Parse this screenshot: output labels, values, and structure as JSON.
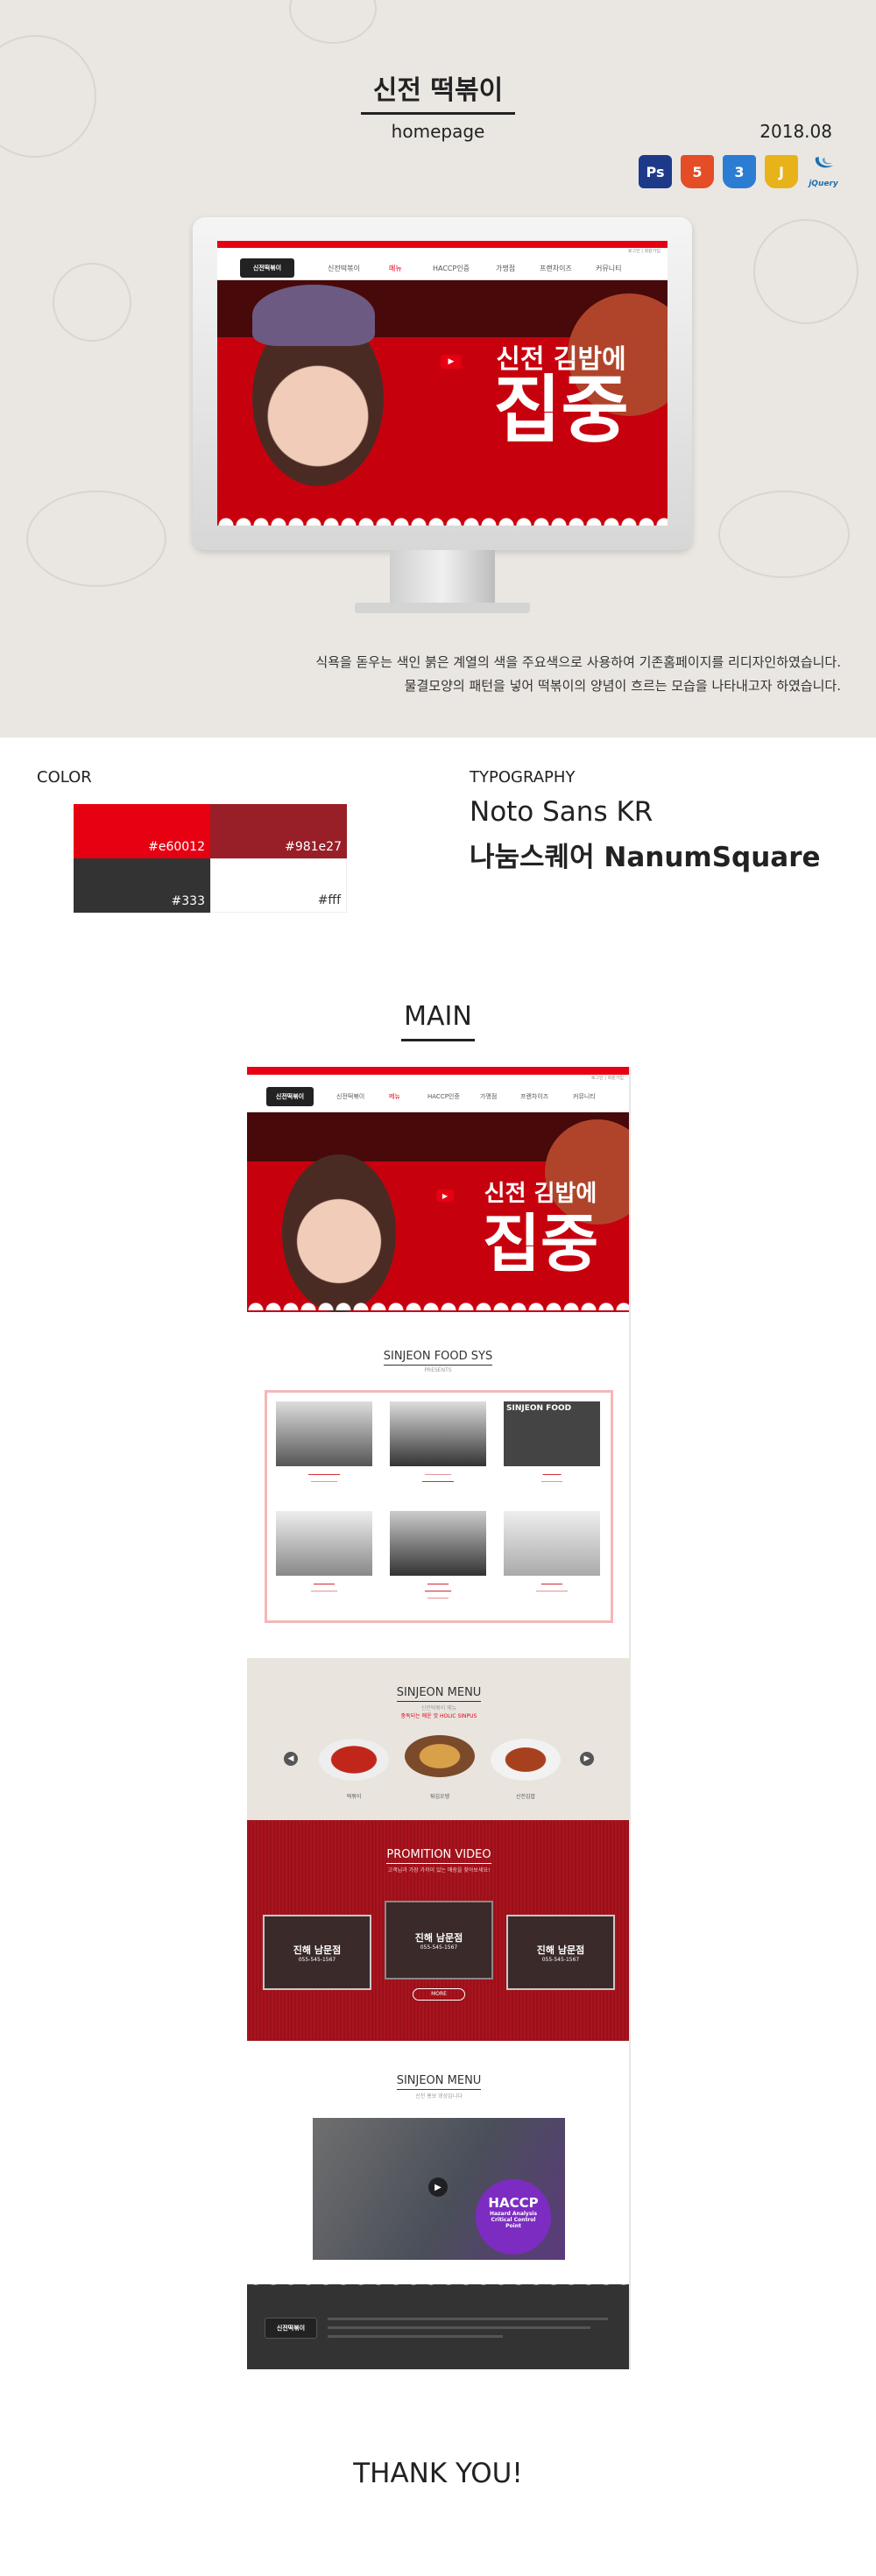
{
  "hero": {
    "title": "신전 떡볶이",
    "subtitle": "homepage",
    "date": "2018.08",
    "tools": [
      {
        "label": "Ps",
        "color": "#1d3a8a",
        "icon": "photoshop-icon"
      },
      {
        "label": "5",
        "color": "#e44d26",
        "icon": "html5-icon"
      },
      {
        "label": "3",
        "color": "#2b7cd3",
        "icon": "css3-icon"
      },
      {
        "label": "J",
        "color": "#e8b21a",
        "icon": "javascript-icon"
      },
      {
        "label": "jQuery",
        "color": "#1a6fb4",
        "icon": "jquery-icon"
      }
    ],
    "desc_line1": "식욕을 돋우는 색인 붉은 계열의 색을 주요색으로 사용하여 기존홈페이지를 리디자인하였습니다.",
    "desc_line2": "물결모양의 패턴을 넣어 떡볶이의 양념이 흐르는 모습을 나타내고자 하였습니다."
  },
  "site_preview": {
    "top_links": "로그인 | 회원가입",
    "logo": "신전떡볶이",
    "nav": [
      "신전떡볶이",
      "메뉴",
      "HACCP인증",
      "가맹점",
      "프랜차이즈",
      "커뮤니티"
    ],
    "headline_small": "신전 김밥에",
    "headline_big": "집중"
  },
  "color_section": {
    "label": "COLOR",
    "swatches": [
      {
        "hex": "#e60012",
        "label": "#e60012",
        "text": "#ffffff"
      },
      {
        "hex": "#981e27",
        "label": "#981e27",
        "text": "#ffffff"
      },
      {
        "hex": "#333333",
        "label": "#333",
        "text": "#ffffff"
      },
      {
        "hex": "#ffffff",
        "label": "#fff",
        "text": "#333333"
      }
    ]
  },
  "typography": {
    "label": "TYPOGRAPHY",
    "font1": "Noto Sans KR",
    "font2": "나눔스퀘어  NanumSquare"
  },
  "main": {
    "label": "MAIN",
    "food_sys": {
      "title": "SINJEON FOOD SYS",
      "sub": "PRESENTS",
      "sign": "SINJEON FOOD"
    },
    "menu": {
      "title": "SINJEON MENU",
      "sub": "신전떡볶이 메뉴",
      "sub2": "중독되는 매운 맛 HOLIC SINPUS",
      "dishes": [
        "떡볶이",
        "튀김오뎅",
        "신전김밥"
      ]
    },
    "video": {
      "title": "PROMITION VIDEO",
      "sub": "고객님과 가장 가까이 있는 매장을 찾아보세요!",
      "store": "진해 남문점",
      "phone": "055-545-1567",
      "more": "MORE"
    },
    "hv": {
      "title": "SINJEON MENU",
      "sub": "신전 홍보 영상입니다",
      "badge1": "HACCP",
      "badge2": "Hazard Analysis",
      "badge3": "Critical Control",
      "badge4": "Point"
    },
    "footer_logo": "신전떡볶이"
  },
  "closing": "THANK YOU!"
}
